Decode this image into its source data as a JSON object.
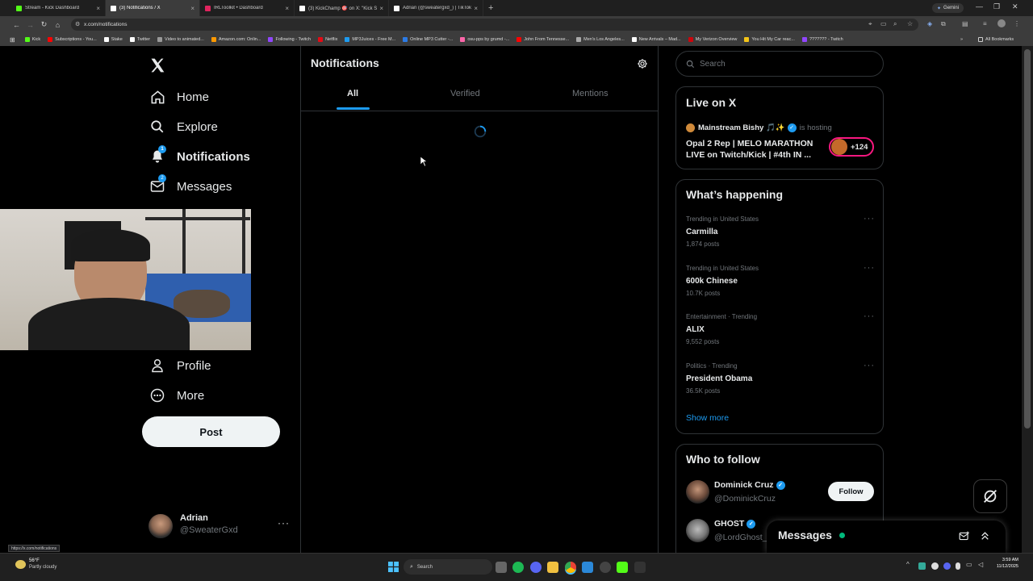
{
  "browser": {
    "tabs": [
      {
        "label": "Stream - Kick Dashboard",
        "color": "#53fc18",
        "active": false
      },
      {
        "label": "(3) Notifications / X",
        "color": "#ffffff",
        "active": true
      },
      {
        "label": "IRLToolkit • Dashboard",
        "color": "#e0245e",
        "active": false
      },
      {
        "label": "(3) KickChamp 🎯 on X: \"Kick St",
        "color": "#ffffff",
        "active": false
      },
      {
        "label": "Adrian (@sweatergxd_) | TikTok",
        "color": "#ffffff",
        "active": false
      }
    ],
    "gemini_label": "Gemini",
    "url": "x.com/notifications",
    "bookmarks": [
      {
        "label": "Kick",
        "color": "#53fc18"
      },
      {
        "label": "Subscriptions - You...",
        "color": "#ff0000"
      },
      {
        "label": "Stake",
        "color": "#ffffff"
      },
      {
        "label": "Twitter",
        "color": "#ffffff"
      },
      {
        "label": "Video to animated...",
        "color": "#999999"
      },
      {
        "label": "Amazon.com: Onlin...",
        "color": "#ff9900"
      },
      {
        "label": "Following - Twitch",
        "color": "#9146ff"
      },
      {
        "label": "Netflix",
        "color": "#e50914"
      },
      {
        "label": "MP3Juices - Free M...",
        "color": "#1d9bf0"
      },
      {
        "label": "Online MP3 Cutter -...",
        "color": "#2c7be5"
      },
      {
        "label": "osu-pps by grumd -...",
        "color": "#ff66aa"
      },
      {
        "label": "John From Tennesse...",
        "color": "#ff0000"
      },
      {
        "label": "Men's Los Angeles...",
        "color": "#aaaaaa"
      },
      {
        "label": "New Arrivals – Mad...",
        "color": "#ffffff"
      },
      {
        "label": "My Verizon Overview",
        "color": "#cd040b"
      },
      {
        "label": "You Hit My Car reac...",
        "color": "#f5c518"
      },
      {
        "label": "??????? - Twitch",
        "color": "#9146ff"
      }
    ],
    "all_bookmarks_label": "All Bookmarks",
    "status_url": "https://x.com/notifications"
  },
  "sidebar": {
    "items": [
      {
        "label": "Home",
        "icon": "home-icon"
      },
      {
        "label": "Explore",
        "icon": "search-icon"
      },
      {
        "label": "Notifications",
        "icon": "bell-icon",
        "badge": "1"
      },
      {
        "label": "Messages",
        "icon": "mail-icon",
        "badge": "2"
      },
      {
        "label": "Profile",
        "icon": "person-icon"
      },
      {
        "label": "More",
        "icon": "more-circle-icon"
      }
    ],
    "post_label": "Post",
    "account": {
      "name": "Adrian",
      "handle": "@SweaterGxd"
    }
  },
  "main": {
    "title": "Notifications",
    "tabs": [
      "All",
      "Verified",
      "Mentions"
    ],
    "active_tab": "All"
  },
  "right": {
    "search_placeholder": "Search",
    "live": {
      "title": "Live on X",
      "host": "Mainstream Bishy 🎵✨",
      "hosting_text": "is hosting",
      "stream_title": "Opal 2 Rep | MELO MARATHON LIVE on Twitch/Kick | #4th IN ...",
      "listeners": "+124"
    },
    "happening": {
      "title": "What’s happening",
      "trends": [
        {
          "category": "Trending in United States",
          "name": "Carmilla",
          "count": "1,874 posts"
        },
        {
          "category": "Trending in United States",
          "name": "600k Chinese",
          "count": "10.7K posts"
        },
        {
          "category": "Entertainment · Trending",
          "name": "ALIX",
          "count": "9,552 posts"
        },
        {
          "category": "Politics · Trending",
          "name": "President Obama",
          "count": "36.5K posts"
        }
      ],
      "show_more": "Show more"
    },
    "who_to_follow": {
      "title": "Who to follow",
      "users": [
        {
          "name": "Dominick Cruz",
          "handle": "@DominickCruz",
          "button": "Follow"
        },
        {
          "name": "GHOST",
          "handle": "@LordGhost_"
        }
      ]
    }
  },
  "messages_drawer": {
    "label": "Messages"
  },
  "taskbar": {
    "weather_temp": "56°F",
    "weather_desc": "Partly cloudy",
    "search_label": "Search",
    "time": "3:59 AM",
    "date": "11/12/2025"
  },
  "colors": {
    "accent": "#1d9bf0",
    "background": "#000000",
    "border": "#2f3336",
    "live_ring": "#f91880",
    "online": "#00ba7c"
  }
}
